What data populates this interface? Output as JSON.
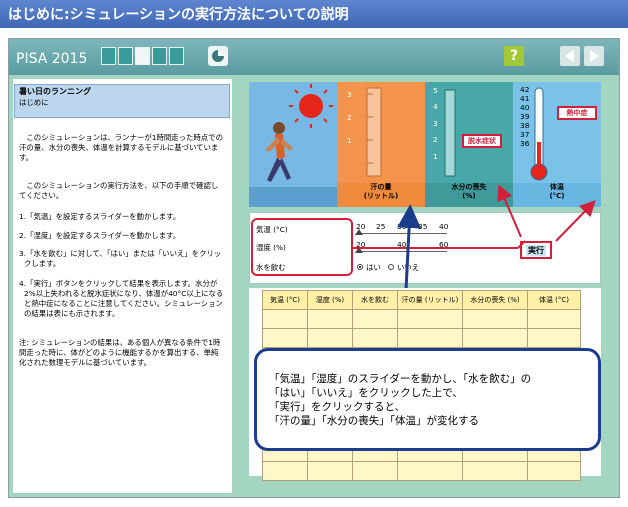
{
  "header": {
    "title": "はじめに:シミュレーションの実行方法についての説明"
  },
  "topbar": {
    "app_name": "PISA 2015"
  },
  "left_panel": {
    "title": "暑い日のランニング",
    "subtitle": "はじめに",
    "intro": "このシミュレーションは、ランナーが1時間走った時点での汗の量、水分の喪失、体温を計算するモデルに基づいています。",
    "procedure_intro": "このシミュレーションの実行方法を、以下の手順で確認してください。",
    "steps": [
      "1.「気温」を設定するスライダーを動かします。",
      "2.「湿度」を設定するスライダーを動かします。",
      "3.「水を飲む」に対して、「はい」または「いいえ」をクリックします。",
      "4.「実行」ボタンをクリックして結果を表示します。水分が2%以上失われると脱水症状になり、体温が40°C以上になると熱中症になることに注意してください。シミュレーションの結果は表にも示されます。"
    ],
    "note": "注: シミュレーションの結果は、ある個人が異なる条件で1時間走った時に、体がどのように機能するかを算出する、単純化された数理モデルに基づいています。"
  },
  "panels": {
    "water": {
      "label_line1": "汗の量",
      "label_line2": "(リットル)",
      "ticks": [
        "3",
        "2",
        "1"
      ]
    },
    "loss": {
      "label_line1": "水分の喪失",
      "label_line2": "(%)",
      "ticks": [
        "5",
        "4",
        "3",
        "2",
        "1"
      ],
      "callout": "脱水症状"
    },
    "temp": {
      "label_line1": "体温",
      "label_line2": "(°C)",
      "ticks": [
        "42",
        "41",
        "40",
        "39",
        "38",
        "37",
        "36"
      ],
      "callout": "熱中症"
    }
  },
  "controls": {
    "temp_label": "気温 (°C)",
    "temp_ticks": [
      "20",
      "25",
      "30",
      "35",
      "40"
    ],
    "temp_value": 20,
    "humidity_label": "湿度 (%)",
    "humidity_ticks": [
      "20",
      "40",
      "60"
    ],
    "humidity_value": 20,
    "drink_label": "水を飲む",
    "drink_yes": "はい",
    "drink_no": "いいえ",
    "drink_selected": "はい",
    "run_label": "実行"
  },
  "table": {
    "headers": [
      "気温 (°C)",
      "湿度 (%)",
      "水を飲む",
      "汗の量 (リットル)",
      "水分の喪失 (%)",
      "体温 (°C)"
    ],
    "rows": 9
  },
  "callout": {
    "line1": "「気温」「湿度」のスライダーを動かし、「水を飲む」の",
    "line2": "「はい」「いいえ」をクリックした上で、",
    "line3": "「実行」をクリックすると、",
    "line4": "「汗の量」「水分の喪失」「体温」が変化する"
  },
  "colors": {
    "header": "#4f77c4",
    "callout_border": "#1c3c8c",
    "alert_red": "#d0203a"
  }
}
